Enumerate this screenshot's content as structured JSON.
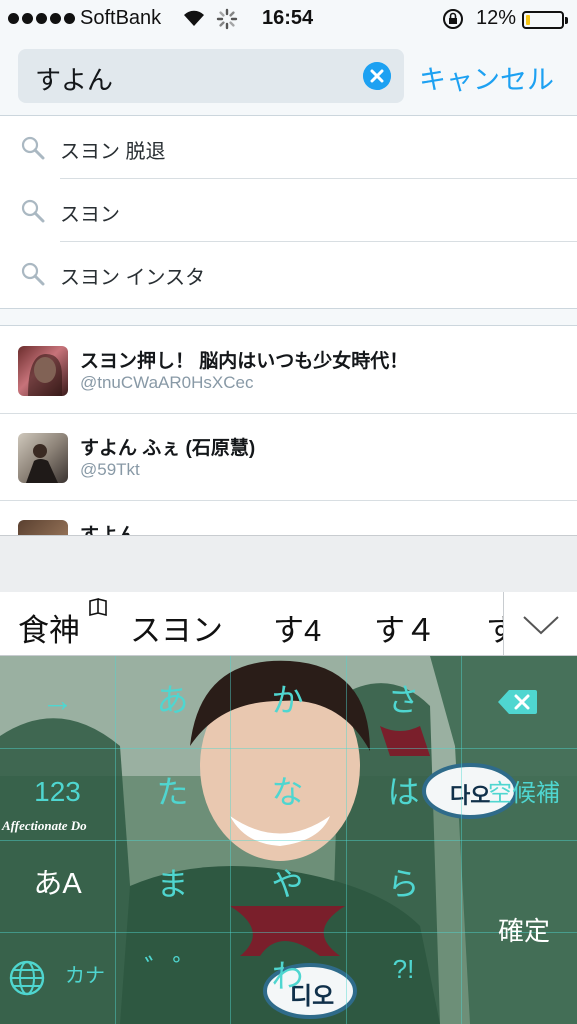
{
  "status_bar": {
    "carrier": "SoftBank",
    "time": "16:54",
    "battery_percent": "12%",
    "battery_level": 0.12
  },
  "search": {
    "query": "すよん",
    "cancel_label": "キャンセル"
  },
  "suggestions": [
    {
      "text": "スヨン 脱退"
    },
    {
      "text": "スヨン"
    },
    {
      "text": "スヨン インスタ"
    }
  ],
  "users": [
    {
      "name": "スヨン押し！ 脳内はいつも少女時代！",
      "handle": "@tnuCWaAR0HsXCec"
    },
    {
      "name": "すよん ふぇ (石原慧)",
      "handle": "@59Tkt"
    },
    {
      "name": "すよん",
      "handle": ""
    }
  ],
  "candidates": [
    "食神",
    "スヨン",
    "す4",
    "す４",
    "す"
  ],
  "keyboard": {
    "row1": [
      "→",
      "あ",
      "か",
      "さ"
    ],
    "row2": [
      "123",
      "た",
      "な",
      "は",
      "空候補"
    ],
    "row3": [
      "あA",
      "ま",
      "や",
      "ら",
      "確定"
    ],
    "row4": [
      "カナ",
      "゛゜",
      "わ",
      "?!"
    ],
    "overlay_text": "Affectionate Do",
    "badge_text": "디오",
    "badge_text_2": "다오"
  },
  "colors": {
    "accent": "#1da1f2",
    "key_text": "#4fd6d0"
  }
}
